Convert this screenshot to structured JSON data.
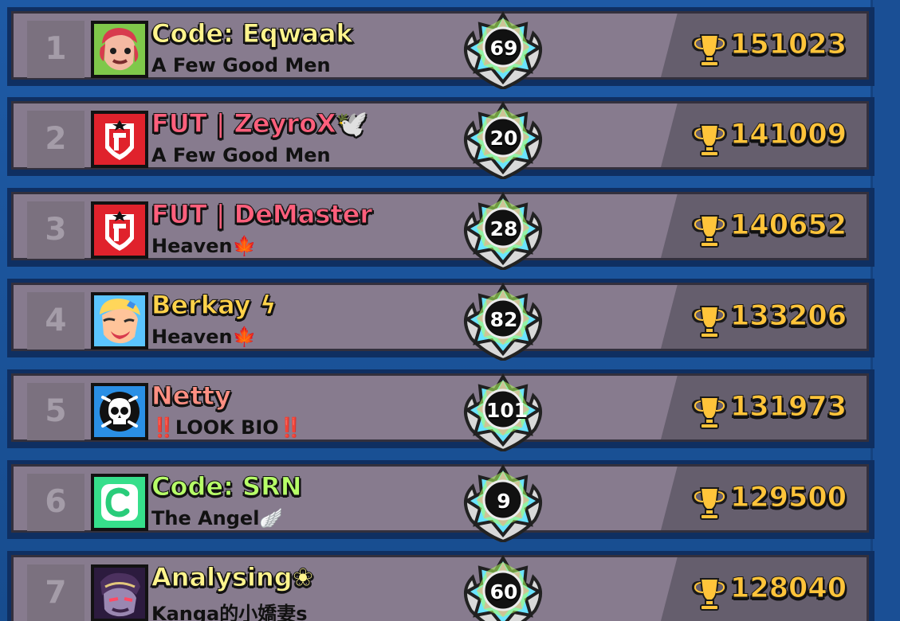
{
  "leaderboard": {
    "rows": [
      {
        "rank": "1",
        "name": "Code: Eqwaak",
        "name_color": "#fff48d",
        "club": "A Few Good Men",
        "level": "69",
        "trophies": "151023",
        "avatar": "red-haired-brawler-avatar"
      },
      {
        "rank": "2",
        "name": "FUT | ZeyroX🕊️",
        "name_color": "#ff5f7c",
        "club": "A Few Good Men",
        "level": "20",
        "trophies": "141009",
        "avatar": "fut-club-logo-avatar"
      },
      {
        "rank": "3",
        "name": "FUT | DeMaster",
        "name_color": "#ff5f7c",
        "club": "Heaven🍁",
        "level": "28",
        "trophies": "140652",
        "avatar": "fut-club-logo-avatar"
      },
      {
        "rank": "4",
        "name": "Berkay ϟ",
        "name_color": "#ffd24a",
        "club": "Heaven🍁",
        "level": "82",
        "trophies": "133206",
        "avatar": "blonde-brawler-avatar"
      },
      {
        "rank": "5",
        "name": "Netty",
        "name_color": "#ff8f82",
        "club": "‼️LOOK BIO‼️",
        "level": "101",
        "trophies": "131973",
        "avatar": "skull-avatar"
      },
      {
        "rank": "6",
        "name": "Code: SRN",
        "name_color": "#b7ff68",
        "club": "The Angel🪽",
        "level": "9",
        "trophies": "129500",
        "avatar": "green-c-logo-avatar"
      },
      {
        "rank": "7",
        "name": "Analysing❀",
        "name_color": "#fff48d",
        "club": "Kanga的小嬌妻s",
        "level": "60",
        "trophies": "128040",
        "avatar": "dark-purple-brawler-avatar"
      }
    ]
  },
  "colors": {
    "background": "#1b4f92",
    "row_outer": "#0f2f61",
    "row_left": "#877b8e",
    "row_right": "#655e6d",
    "trophy": "#ffc43a"
  },
  "icons": {
    "trophy": "trophy-icon",
    "badge": "prestige-level-badge-icon"
  }
}
